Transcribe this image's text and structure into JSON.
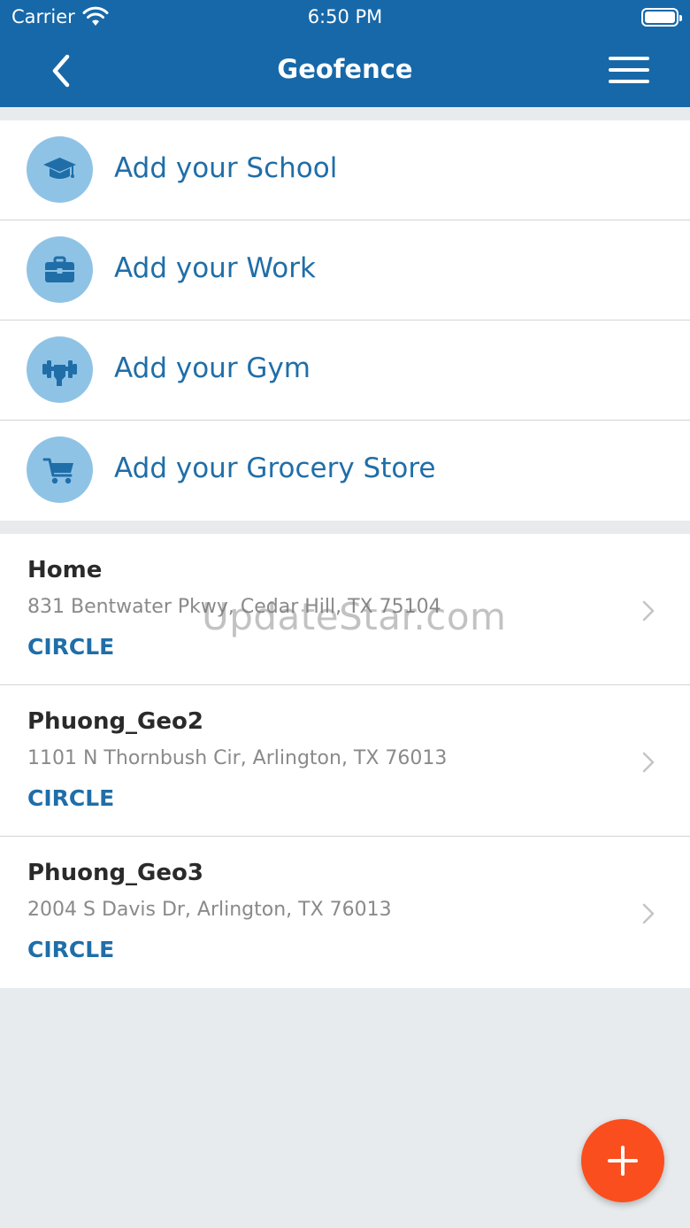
{
  "status_bar": {
    "carrier": "Carrier",
    "time": "6:50 PM"
  },
  "header": {
    "title": "Geofence"
  },
  "shortcuts": [
    {
      "label": "Add your School",
      "icon": "graduation-cap-icon"
    },
    {
      "label": "Add your Work",
      "icon": "briefcase-icon"
    },
    {
      "label": "Add your Gym",
      "icon": "dumbbell-icon"
    },
    {
      "label": "Add your Grocery Store",
      "icon": "shopping-cart-icon"
    }
  ],
  "places": [
    {
      "name": "Home",
      "address": "831 Bentwater Pkwy, Cedar Hill, TX 75104",
      "type": "CIRCLE"
    },
    {
      "name": "Phuong_Geo2",
      "address": "1101 N Thornbush Cir, Arlington, TX 76013",
      "type": "CIRCLE"
    },
    {
      "name": "Phuong_Geo3",
      "address": "2004 S Davis Dr, Arlington, TX 76013",
      "type": "CIRCLE"
    }
  ],
  "watermark": "UpdateStar.com",
  "colors": {
    "header": "#1768a8",
    "accent": "#1f6ea8",
    "icon_bg": "#8fc3e6",
    "fab": "#fa4e1e",
    "background": "#e8ebed"
  }
}
